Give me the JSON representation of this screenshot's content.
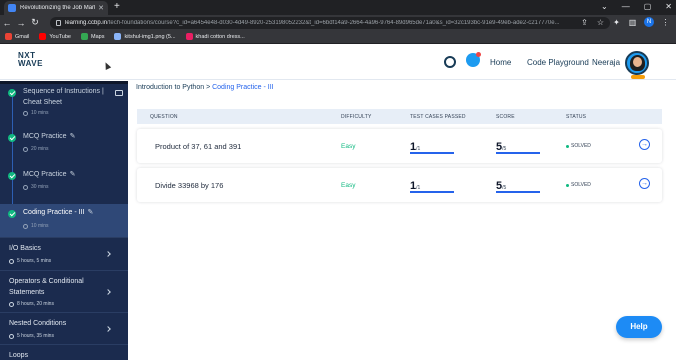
{
  "browser": {
    "tab_title": "Revolutionizing the Job Market |",
    "url_host": "learning.ccbp.in",
    "url_path": "/tech-foundations/course?c_id=a6454e48-d030-4d49-8920-253198052232&t_id=6bdf14a9-2664-4a96-9764-89d965de71a0&s_id=32c193bc-91e9-49eb-ade2-c217770e...",
    "profile_initial": "N",
    "bookmarks": [
      {
        "label": "Gmail",
        "color": "#ea4335"
      },
      {
        "label": "YouTube",
        "color": "#ff0000"
      },
      {
        "label": "Maps",
        "color": "#34a853"
      },
      {
        "label": "kitshul-img1.png (5...",
        "color": "#8ab4f8"
      },
      {
        "label": "khadi cotton dress...",
        "color": "#e91e63"
      }
    ]
  },
  "header": {
    "logo_top": "NXT",
    "logo_bottom": "WAVE",
    "nav": [
      "Home",
      "Code Playground",
      "Neeraja"
    ]
  },
  "sidebar": {
    "steps": [
      {
        "title": "Sequence of Instructions | Cheat Sheet",
        "duration": "10 mins",
        "icon": "book-icon"
      },
      {
        "title": "MCQ Practice",
        "duration": "20 mins",
        "icon": "pencil-icon"
      },
      {
        "title": "MCQ Practice",
        "duration": "30 mins",
        "icon": "pencil-icon"
      },
      {
        "title": "Coding Practice - III",
        "duration": "10 mins",
        "icon": "pencil-icon"
      }
    ],
    "modules": [
      {
        "title": "I/O Basics",
        "duration": "5 hours, 5 mins"
      },
      {
        "title": "Operators & Conditional Statements",
        "duration": "8 hours, 20 mins"
      },
      {
        "title": "Nested Conditions",
        "duration": "5 hours, 35 mins"
      },
      {
        "title": "Loops",
        "duration": ""
      }
    ]
  },
  "main": {
    "breadcrumb_root": "Introduction to Python",
    "breadcrumb_sep": ">",
    "breadcrumb_current": "Coding Practice - III",
    "columns": [
      "QUESTION",
      "DIFFICULTY",
      "TEST CASES PASSED",
      "SCORE",
      "STATUS"
    ],
    "rows": [
      {
        "question": "Product of 37, 61 and 391",
        "difficulty": "Easy",
        "tests_passed": "1",
        "tests_total": "/1",
        "score": "5",
        "score_total": "/5",
        "status": "SOLVED"
      },
      {
        "question": "Divide 33968 by 176",
        "difficulty": "Easy",
        "tests_passed": "1",
        "tests_total": "/1",
        "score": "5",
        "score_total": "/5",
        "status": "SOLVED"
      }
    ]
  },
  "help_label": "Help",
  "colors": {
    "sidebar_bg": "#1b2b4e",
    "accent_blue": "#2563eb",
    "success_green": "#10b981",
    "help_button": "#1d8bf5"
  }
}
